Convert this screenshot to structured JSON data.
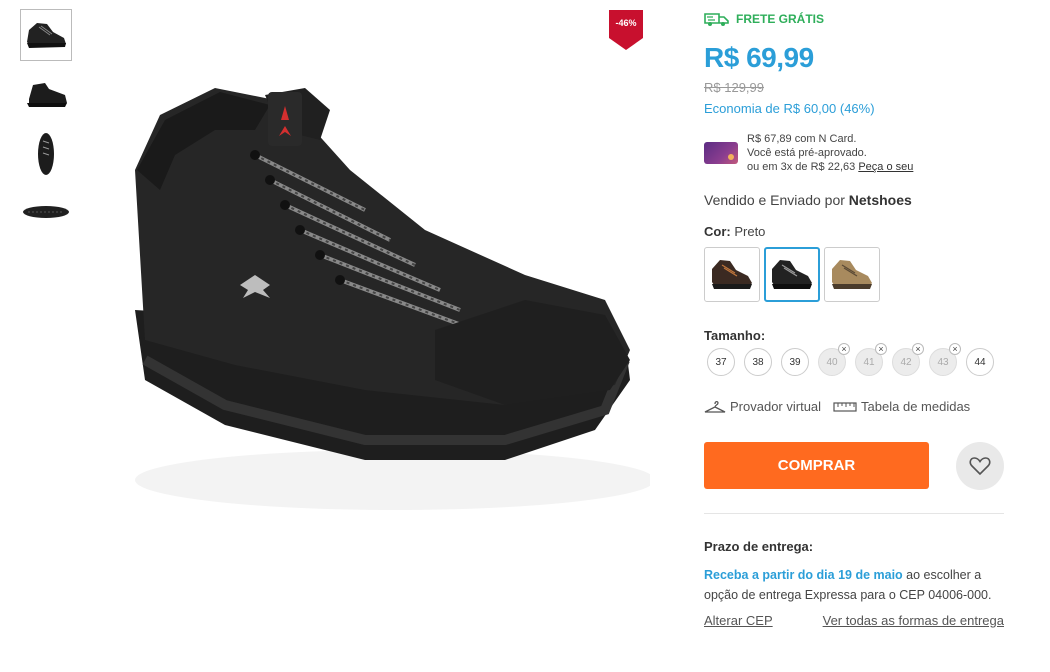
{
  "product": {
    "discount_badge": "-46%",
    "shipping_label": "FRETE GRÁTIS",
    "price": "R$ 69,99",
    "old_price": "R$ 129,99",
    "saving": "Economia de R$ 60,00 (46%)",
    "ncard": {
      "line1": "R$ 67,89 com N Card.",
      "line2": "Você está pré-aprovado.",
      "line3": "ou em 3x de R$ 22,63",
      "link": "Peça o seu"
    },
    "seller_prefix": "Vendido e Enviado por",
    "seller_name": "Netshoes",
    "color_label": "Cor:",
    "color_value": "Preto",
    "size_label": "Tamanho:",
    "sizes": [
      {
        "label": "37",
        "available": true
      },
      {
        "label": "38",
        "available": true
      },
      {
        "label": "39",
        "available": true
      },
      {
        "label": "40",
        "available": false
      },
      {
        "label": "41",
        "available": false
      },
      {
        "label": "42",
        "available": false
      },
      {
        "label": "43",
        "available": false
      },
      {
        "label": "44",
        "available": true
      }
    ],
    "unavailable_mark": "×",
    "virtual_fitting": "Provador virtual",
    "size_chart": "Tabela de medidas",
    "buy_label": "COMPRAR"
  },
  "delivery": {
    "title": "Prazo de entrega:",
    "highlight": "Receba a partir do dia 19 de maio",
    "rest": " ao escolher a opção de entrega Expressa para o CEP 04006-000.",
    "change_cep": "Alterar CEP",
    "all_options": "Ver todas as formas de entrega"
  },
  "colors": {
    "accent": "#2b9ed8",
    "buy_button": "#ff6a1f",
    "free_shipping": "#2eae5a",
    "badge": "#c8102e"
  },
  "icons": {
    "shipping": "truck-icon",
    "hanger": "hanger-icon",
    "ruler": "ruler-icon",
    "wishlist": "heart-icon"
  }
}
